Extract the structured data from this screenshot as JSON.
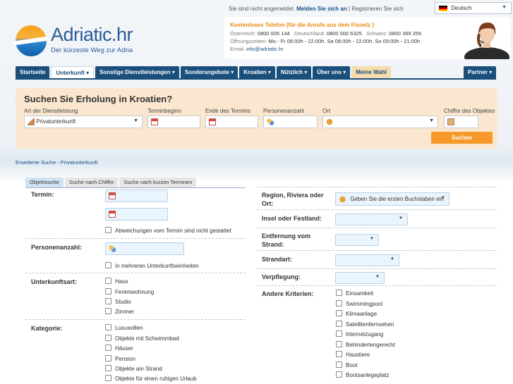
{
  "top": {
    "status": "Sie sind nicht angemeldet.",
    "login": "Melden Sie sich an",
    "divider": "|",
    "register": "Registrieren Sie sich",
    "language": "Deutsch"
  },
  "logo": {
    "name": "Adriatic",
    "tld": ".hr",
    "slogan": "Der kürzeste Weg zur Adria"
  },
  "contact": {
    "title": "Kostenloses Telefon (für die Anrufe aus dem Fixnetz )",
    "at_label": "Österreich:",
    "at": "0800 005 144",
    "de_label": "Deutschland:",
    "de": "0800 000 6325",
    "ch_label": "Schweiz:",
    "ch": "0800 369 255",
    "hours_label": "Öffnungszeiten:",
    "hours": "Mo - Fr 08:00h - 22:00h. Sa 08:00h - 22:00h. So 09:00h - 21:00h",
    "email_label": "Email:",
    "email": "info@adriatic.hr"
  },
  "nav": {
    "items": [
      {
        "label": "Startseite"
      },
      {
        "label": "Unterkunft ▾"
      },
      {
        "label": "Sonstige Dienstleistungen ▾"
      },
      {
        "label": "Sonderangebote ▾"
      },
      {
        "label": "Kroatien ▾"
      },
      {
        "label": "Nützlich ▾"
      },
      {
        "label": "Über uns ▾"
      },
      {
        "label": "Meine Wahl"
      }
    ],
    "partner": "Partner ▾"
  },
  "search": {
    "title": "Suchen Sie Erholung in Kroatien?",
    "service_label": "Art der Dienstleistung",
    "service_value": "Privatunterkunft",
    "start_label": "Terminbeginn",
    "end_label": "Ende des Termins",
    "persons_label": "Personenanzahl",
    "place_label": "Ort",
    "code_label": "Chiffre des Objektes",
    "button": "Suchen"
  },
  "breadcrumb": "Erweiterte Suche - Privatunterkunft",
  "tabs": [
    "Objektsuche",
    "Suche nach Chiffre",
    "Suche nach kurzen Terminen"
  ],
  "form_left": {
    "termin_label": "Termin:",
    "deviation_label": "Abweichungen vom Termin sind nicht gestattet",
    "persons_label": "Personenanzahl:",
    "multi_units_label": "In mehreren Unterkunftseinheiten",
    "type_label": "Unterkunftsart:",
    "types": [
      "Haus",
      "Ferienwohnung",
      "Studio",
      "Zimmer"
    ],
    "category_label": "Kategorie:",
    "categories": [
      "Luxusvillen",
      "Objekte mit Schwimmbad",
      "Häuser",
      "Pension",
      "Objekte am Strand",
      "Objekte für einen ruhigen Urlaub"
    ]
  },
  "form_right": {
    "region_label": "Region, Riviera oder Ort:",
    "region_placeholder": "Geben Sie die ersten Buchstaben ein",
    "island_label": "Insel oder Festland:",
    "distance_label": "Entfernung vom Strand:",
    "beach_label": "Strandart:",
    "board_label": "Verpflegung:",
    "criteria_label": "Andere Kriterien:",
    "criteria": [
      "Einsamkeit",
      "Swimmingpool",
      "Klimaanlage",
      "Satellitenfernsehen",
      "Internetzugang",
      "Behindertengerecht",
      "Haustiere",
      "Boot",
      "Bootsanlegeplatz"
    ]
  },
  "colors": {
    "nav": "#1a4f7c",
    "accent": "#f59a2a",
    "search_bg": "#fbe7cf"
  }
}
